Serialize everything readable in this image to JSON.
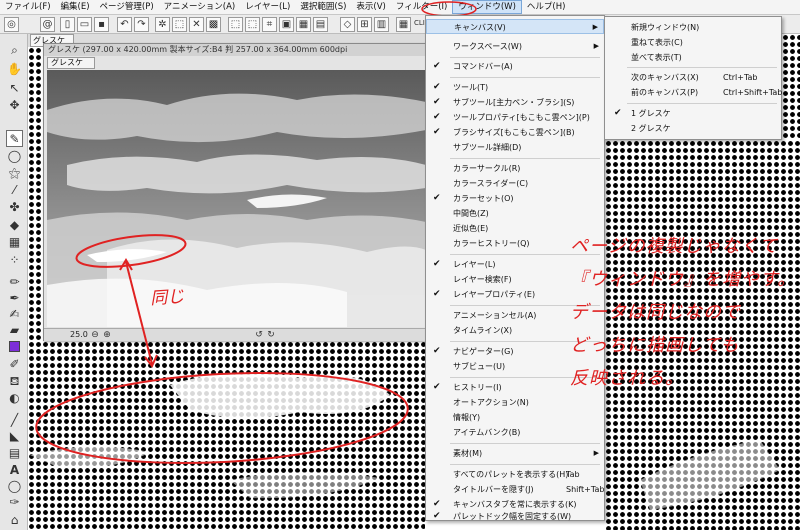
{
  "menubar": {
    "items": [
      "ファイル(F)",
      "編集(E)",
      "ページ管理(P)",
      "アニメーション(A)",
      "レイヤー(L)",
      "選択範囲(S)",
      "表示(V)",
      "フィルター(I)",
      "ウィンドウ(W)",
      "ヘルプ(H)"
    ]
  },
  "commandbar": {
    "clip_label": "CLIP"
  },
  "document": {
    "tab_label": "グレスケ",
    "window_title": "グレスケ (297.00 x 420.00mm 製本サイズ:B4 判 257.00 x 364.00mm 600dpi",
    "inner_tab_label": "グレスケ",
    "zoom": "25.0"
  },
  "window_menu": {
    "items": [
      {
        "label": "キャンバス(V)",
        "checked": false,
        "submenu": true,
        "shortcut": ""
      },
      {
        "label": "ワークスペース(W)",
        "checked": false,
        "submenu": true,
        "shortcut": ""
      },
      {
        "label": "コマンドバー(A)",
        "checked": true,
        "submenu": false,
        "shortcut": ""
      },
      {
        "label": "ツール(T)",
        "checked": true,
        "submenu": false,
        "shortcut": ""
      },
      {
        "label": "サブツール[主力ペン・ブラシ](S)",
        "checked": true,
        "submenu": false,
        "shortcut": ""
      },
      {
        "label": "ツールプロパティ[もこもこ雲ペン](P)",
        "checked": true,
        "submenu": false,
        "shortcut": ""
      },
      {
        "label": "ブラシサイズ[もこもこ雲ペン](B)",
        "checked": true,
        "submenu": false,
        "shortcut": ""
      },
      {
        "label": "サブツール詳細(D)",
        "checked": false,
        "submenu": false,
        "shortcut": ""
      },
      {
        "label": "カラーサークル(R)",
        "checked": false,
        "submenu": false,
        "shortcut": ""
      },
      {
        "label": "カラースライダー(C)",
        "checked": false,
        "submenu": false,
        "shortcut": ""
      },
      {
        "label": "カラーセット(O)",
        "checked": true,
        "submenu": false,
        "shortcut": ""
      },
      {
        "label": "中間色(Z)",
        "checked": false,
        "submenu": false,
        "shortcut": ""
      },
      {
        "label": "近似色(E)",
        "checked": false,
        "submenu": false,
        "shortcut": ""
      },
      {
        "label": "カラーヒストリー(Q)",
        "checked": false,
        "submenu": false,
        "shortcut": ""
      },
      {
        "label": "レイヤー(L)",
        "checked": true,
        "submenu": false,
        "shortcut": ""
      },
      {
        "label": "レイヤー検索(F)",
        "checked": false,
        "submenu": false,
        "shortcut": ""
      },
      {
        "label": "レイヤープロパティ(E)",
        "checked": true,
        "submenu": false,
        "shortcut": ""
      },
      {
        "label": "アニメーションセル(A)",
        "checked": false,
        "submenu": false,
        "shortcut": ""
      },
      {
        "label": "タイムライン(X)",
        "checked": false,
        "submenu": false,
        "shortcut": ""
      },
      {
        "label": "ナビゲーター(G)",
        "checked": true,
        "submenu": false,
        "shortcut": ""
      },
      {
        "label": "サブビュー(U)",
        "checked": false,
        "submenu": false,
        "shortcut": ""
      },
      {
        "label": "ヒストリー(I)",
        "checked": true,
        "submenu": false,
        "shortcut": ""
      },
      {
        "label": "オートアクション(N)",
        "checked": false,
        "submenu": false,
        "shortcut": ""
      },
      {
        "label": "情報(Y)",
        "checked": false,
        "submenu": false,
        "shortcut": ""
      },
      {
        "label": "アイテムバンク(B)",
        "checked": false,
        "submenu": false,
        "shortcut": ""
      },
      {
        "label": "素材(M)",
        "checked": false,
        "submenu": true,
        "shortcut": ""
      },
      {
        "label": "すべてのパレットを表示する(H)",
        "checked": false,
        "submenu": false,
        "shortcut": "Tab"
      },
      {
        "label": "タイトルバーを隠す(J)",
        "checked": false,
        "submenu": false,
        "shortcut": "Shift+Tab"
      },
      {
        "label": "キャンバスタブを常に表示する(K)",
        "checked": true,
        "submenu": false,
        "shortcut": ""
      },
      {
        "label": "パレットドック幅を固定する(W)",
        "checked": true,
        "submenu": false,
        "shortcut": ""
      }
    ]
  },
  "canvas_submenu": {
    "items": [
      {
        "label": "新規ウィンドウ(N)",
        "shortcut": "",
        "checked": false
      },
      {
        "label": "重ねて表示(C)",
        "shortcut": "",
        "checked": false
      },
      {
        "label": "並べて表示(T)",
        "shortcut": "",
        "checked": false
      },
      {
        "label": "次のキャンバス(X)",
        "shortcut": "Ctrl+Tab",
        "checked": false
      },
      {
        "label": "前のキャンバス(P)",
        "shortcut": "Ctrl+Shift+Tab",
        "checked": false
      },
      {
        "label": "1 グレスケ",
        "shortcut": "",
        "checked": true
      },
      {
        "label": "2 グレスケ",
        "shortcut": "",
        "checked": false
      }
    ]
  },
  "annotation": {
    "same_label": "同じ",
    "note_lines": [
      "ページの複製じゃなくて",
      "『ウィンドウ』を増やす。",
      "データは同じなので",
      "どっちに描画しても",
      "反映される。"
    ],
    "accent_color": "#e02222"
  }
}
